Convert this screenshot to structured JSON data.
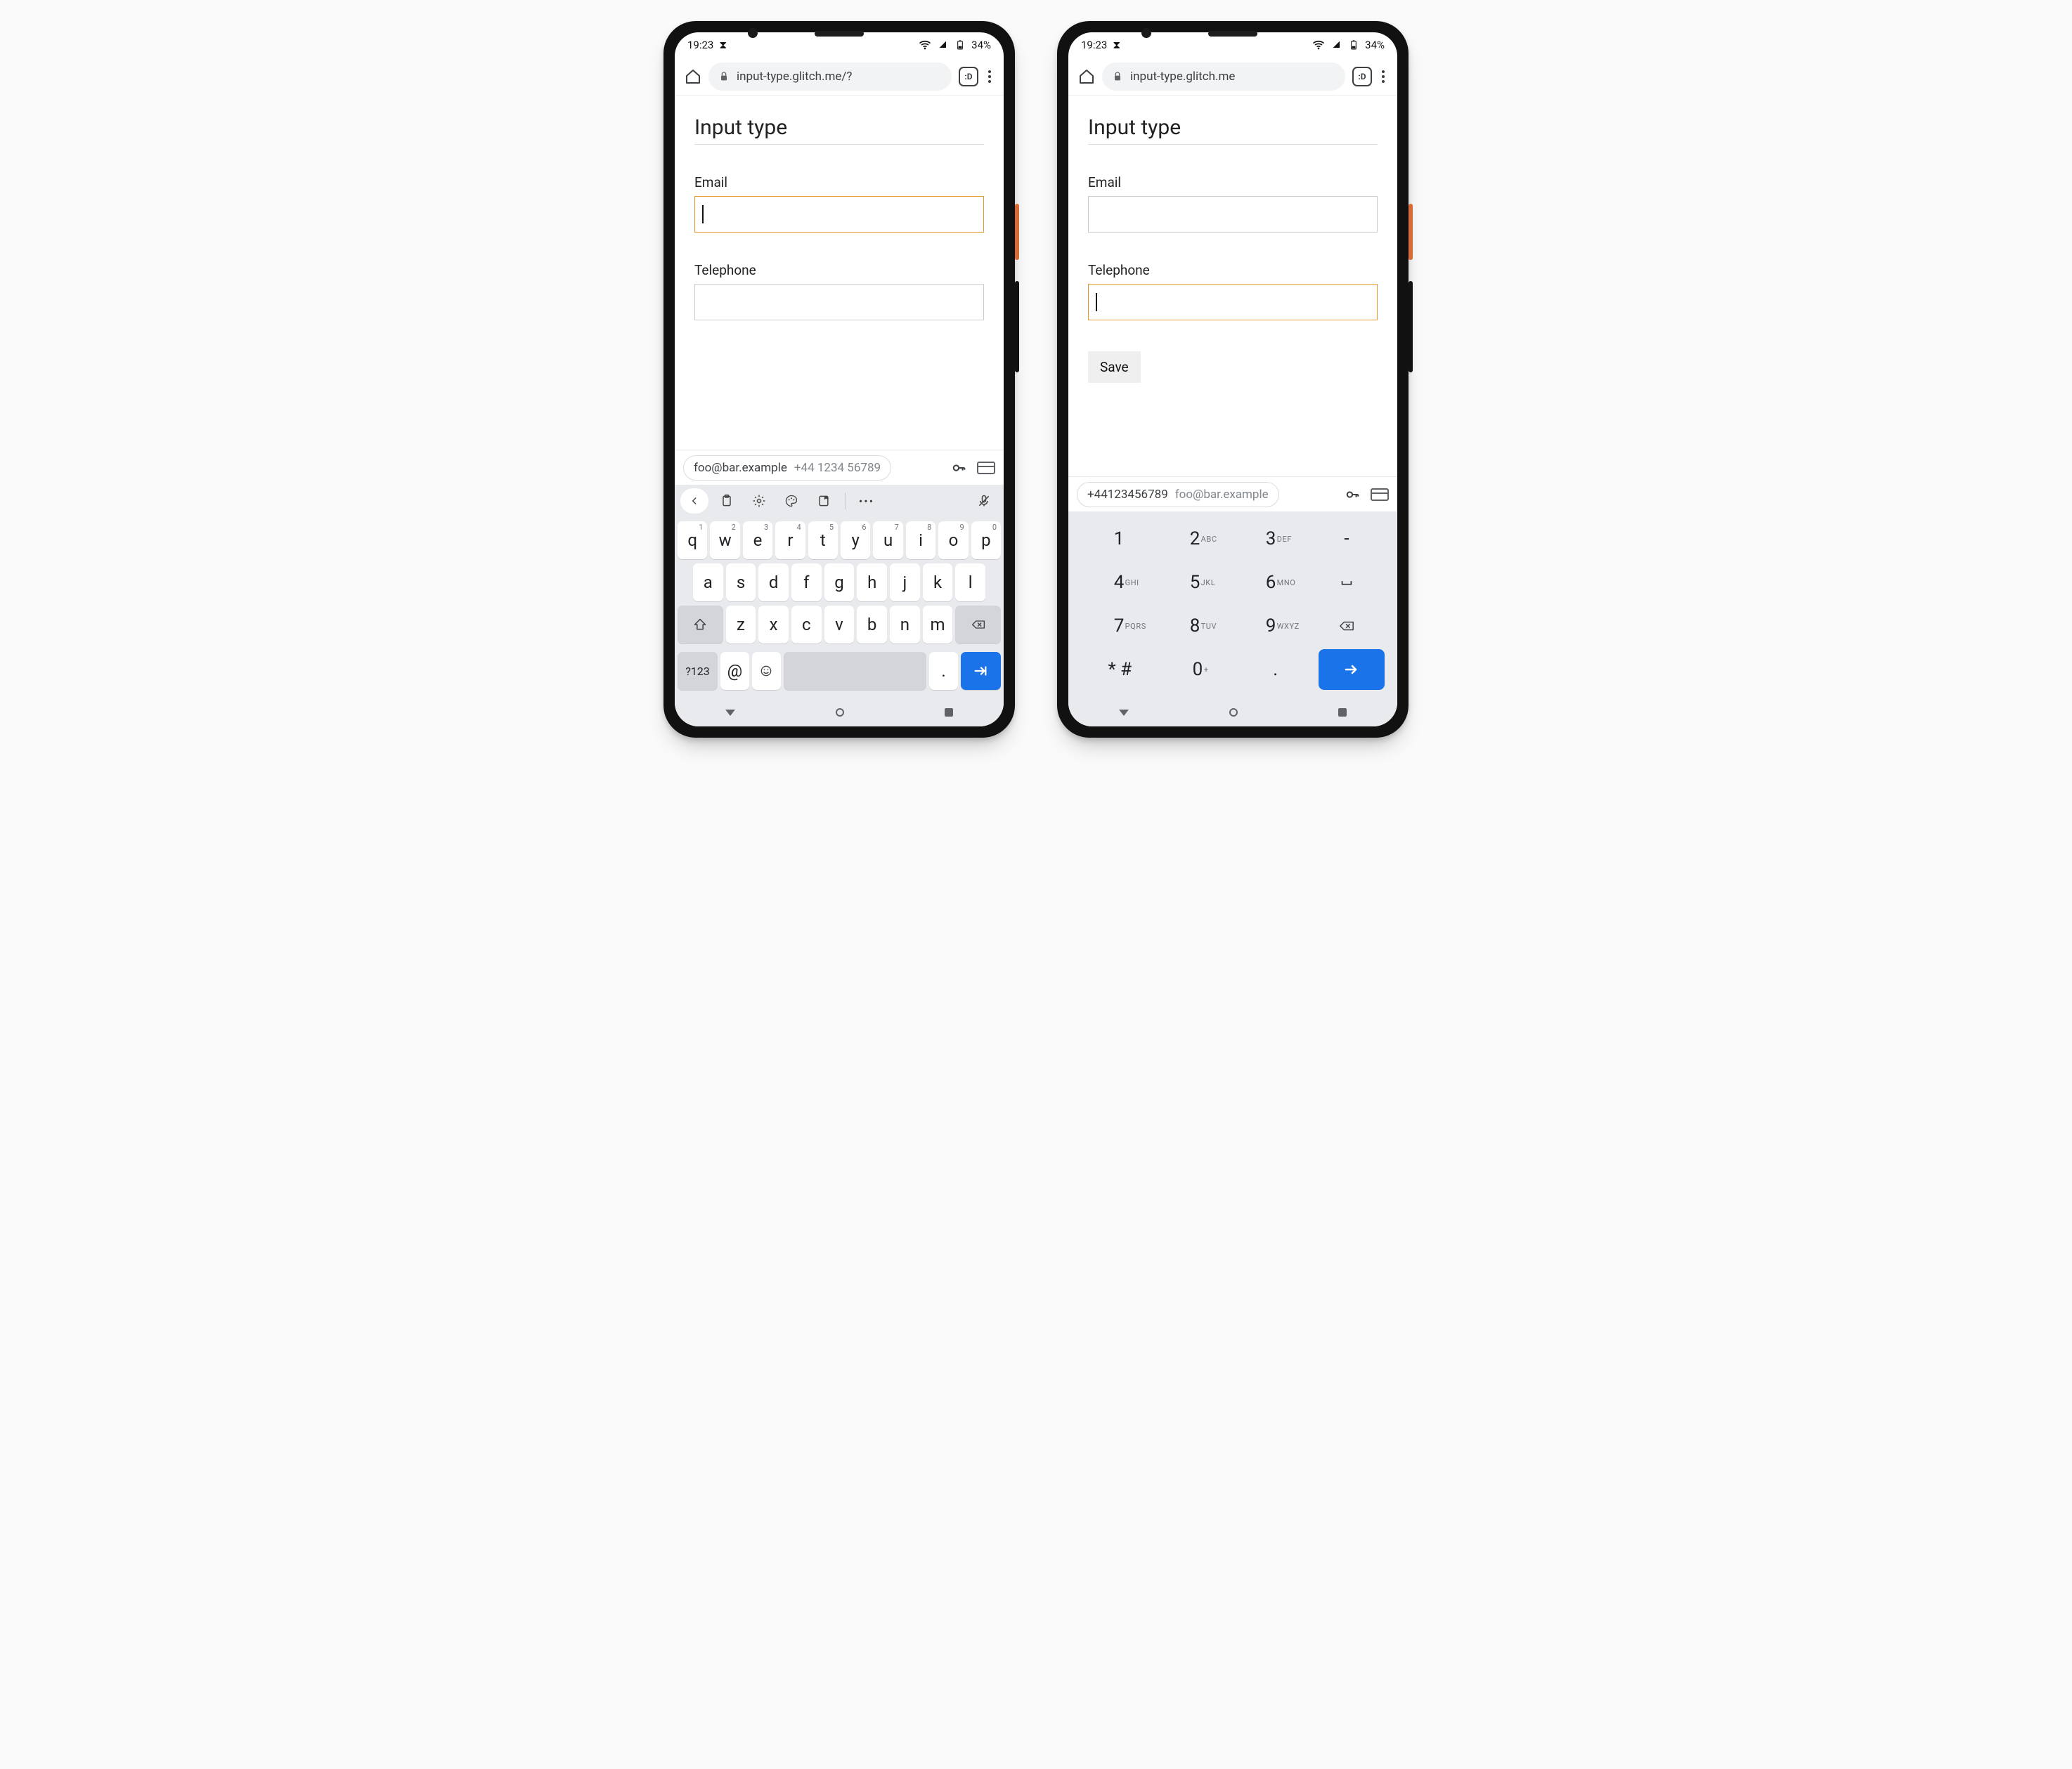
{
  "status": {
    "time": "19:23",
    "battery_text": "34%"
  },
  "page": {
    "heading": "Input type",
    "email_label": "Email",
    "tel_label": "Telephone",
    "save_label": "Save"
  },
  "phone_left": {
    "url": "input-type.glitch.me/?",
    "focused_field": "email",
    "suggestion_primary": "foo@bar.example",
    "suggestion_secondary": "+44 1234 56789",
    "save_visible": false,
    "toolbar_visible": true
  },
  "phone_right": {
    "url": "input-type.glitch.me",
    "focused_field": "telephone",
    "suggestion_primary": "+44123456789",
    "suggestion_secondary": "foo@bar.example",
    "save_visible": true,
    "toolbar_visible": false
  },
  "qwerty": {
    "r1": [
      {
        "k": "q",
        "s": "1"
      },
      {
        "k": "w",
        "s": "2"
      },
      {
        "k": "e",
        "s": "3"
      },
      {
        "k": "r",
        "s": "4"
      },
      {
        "k": "t",
        "s": "5"
      },
      {
        "k": "y",
        "s": "6"
      },
      {
        "k": "u",
        "s": "7"
      },
      {
        "k": "i",
        "s": "8"
      },
      {
        "k": "o",
        "s": "9"
      },
      {
        "k": "p",
        "s": "0"
      }
    ],
    "r2": [
      "a",
      "s",
      "d",
      "f",
      "g",
      "h",
      "j",
      "k",
      "l"
    ],
    "r3": [
      "z",
      "x",
      "c",
      "v",
      "b",
      "n",
      "m"
    ],
    "sym_label": "?123",
    "at_label": "@",
    "dot_label": "."
  },
  "numpad": {
    "rows": [
      [
        {
          "d": "1"
        },
        {
          "d": "2",
          "l": "ABC"
        },
        {
          "d": "3",
          "l": "DEF"
        },
        {
          "d": "-"
        }
      ],
      [
        {
          "d": "4",
          "l": "GHI"
        },
        {
          "d": "5",
          "l": "JKL"
        },
        {
          "d": "6",
          "l": "MNO"
        },
        {
          "sp": true
        }
      ],
      [
        {
          "d": "7",
          "l": "PQRS"
        },
        {
          "d": "8",
          "l": "TUV"
        },
        {
          "d": "9",
          "l": "WXYZ"
        },
        {
          "bksp": true
        }
      ],
      [
        {
          "d": "* #"
        },
        {
          "d": "0",
          "l": "+"
        },
        {
          "d": "."
        },
        {
          "enter": true
        }
      ]
    ]
  }
}
